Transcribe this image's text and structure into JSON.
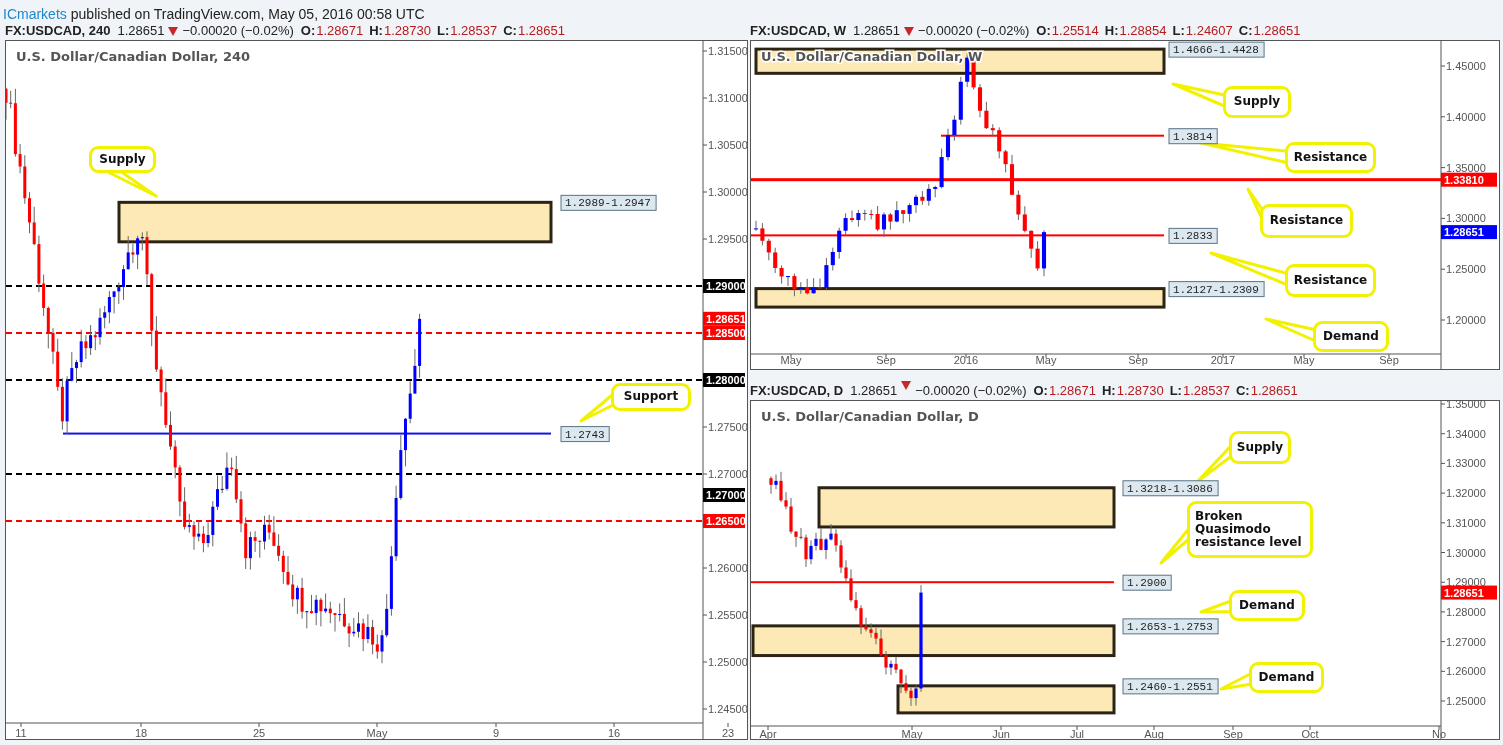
{
  "publisher": {
    "name": "ICmarkets",
    "text": "published on TradingView.com, May 05, 2016 00:58 UTC"
  },
  "charts": [
    {
      "symbol": "FX:USDCAD, 240",
      "price": "1.28651",
      "falling": true,
      "change": "−0.00020 (−0.02%)",
      "ohlc": [
        {
          "label": "O:",
          "value": "1.28671"
        },
        {
          "label": "H:",
          "value": "1.28730"
        },
        {
          "label": "L:",
          "value": "1.28537"
        },
        {
          "label": "C:",
          "value": "1.28651"
        }
      ],
      "title": "U.S. Dollar/Canadian Dollar, 240",
      "y_ticks": [
        "1.31500",
        "1.31000",
        "1.30500",
        "1.30000",
        "1.29500",
        "1.27500",
        "1.27000",
        "1.26000",
        "1.25500",
        "1.25000",
        "1.24500"
      ],
      "x_labels": [
        "11",
        "18",
        "25",
        "May",
        "9",
        "16",
        "23"
      ],
      "price_labels": [
        {
          "text": "1.29000",
          "color": "#000000",
          "line": true,
          "dashed": true
        },
        {
          "text": "1.28651",
          "color": "#ff0000",
          "line": false
        },
        {
          "text": "1.28500",
          "color": "#ff0000",
          "line": true,
          "dashed": true
        },
        {
          "text": "1.28000",
          "color": "#000000",
          "line": true,
          "dashed": true
        },
        {
          "text": "1.27000",
          "color": "#000000",
          "line": true,
          "dashed": true
        },
        {
          "text": "1.26500",
          "color": "#ff0000",
          "line": true,
          "dashed": true
        }
      ],
      "zones": [
        {
          "range": "1.2989-1.2947"
        }
      ],
      "levels": [
        {
          "label": "1.2743",
          "color": "#1515e6"
        }
      ],
      "callouts": [
        "Supply",
        "Support"
      ]
    },
    {
      "symbol": "FX:USDCAD, W",
      "price": "1.28651",
      "falling": true,
      "change": "−0.00020 (−0.02%)",
      "ohlc": [
        {
          "label": "O:",
          "value": "1.25514"
        },
        {
          "label": "H:",
          "value": "1.28854"
        },
        {
          "label": "L:",
          "value": "1.24607"
        },
        {
          "label": "C:",
          "value": "1.28651"
        }
      ],
      "title": "U.S. Dollar/Canadian Dollar, W",
      "y_ticks": [
        "1.45000",
        "1.40000",
        "1.35000",
        "1.30000",
        "1.25000",
        "1.20000"
      ],
      "x_labels": [
        "May",
        "Sep",
        "2016",
        "May",
        "Sep",
        "2017",
        "May",
        "Sep"
      ],
      "price_labels": [
        {
          "text": "1.33810",
          "color": "#ff0000",
          "line": true,
          "dashed": false
        },
        {
          "text": "1.28651",
          "color": "#0000ff",
          "line": false
        }
      ],
      "zones": [
        {
          "range": "1.4666-1.4428"
        },
        {
          "range": "1.2127-1.2309"
        }
      ],
      "levels": [
        {
          "label": "1.3814",
          "color": "#ff0000"
        },
        {
          "label": "1.2833",
          "color": "#ff0000"
        }
      ],
      "callouts": [
        "Supply",
        "Resistance",
        "Resistance",
        "Resistance",
        "Demand"
      ]
    },
    {
      "symbol": "FX:USDCAD, D",
      "price": "1.28651",
      "falling": true,
      "change": "−0.00020 (−0.02%)",
      "ohlc": [
        {
          "label": "O:",
          "value": "1.28671"
        },
        {
          "label": "H:",
          "value": "1.28730"
        },
        {
          "label": "L:",
          "value": "1.28537"
        },
        {
          "label": "C:",
          "value": "1.28651"
        }
      ],
      "title": "U.S. Dollar/Canadian Dollar, D",
      "y_ticks": [
        "1.35000",
        "1.34000",
        "1.33000",
        "1.32000",
        "1.31000",
        "1.30000",
        "1.29000",
        "1.28000",
        "1.27000",
        "1.26000",
        "1.25000"
      ],
      "x_labels": [
        "Apr",
        "May",
        "Jun",
        "Jul",
        "Aug",
        "Sep",
        "Oct",
        "No"
      ],
      "price_labels": [
        {
          "text": "1.28651",
          "color": "#ff0000",
          "line": false
        }
      ],
      "zones": [
        {
          "range": "1.3218-1.3086"
        },
        {
          "range": "1.2653-1.2753"
        },
        {
          "range": "1.2460-1.2551"
        }
      ],
      "levels": [
        {
          "label": "1.2900",
          "color": "#ff0000"
        }
      ],
      "callouts": [
        "Supply",
        "Broken Quasimodo resistance level",
        "Demand",
        "Demand"
      ]
    }
  ]
}
